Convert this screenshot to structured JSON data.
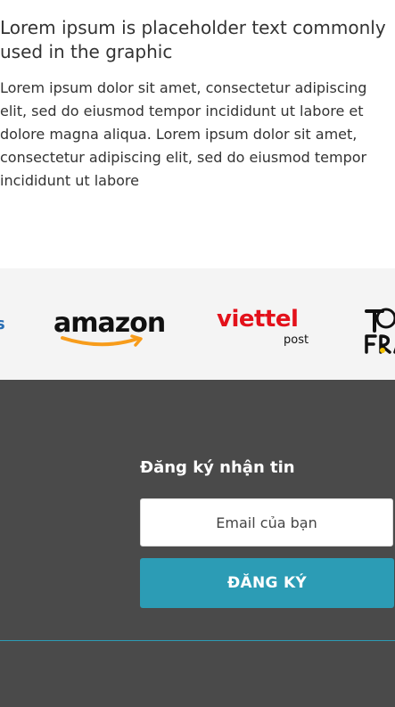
{
  "intro": {
    "heading": "Lorem ipsum is placeholder text commonly used in the graphic",
    "body": "Lorem ipsum dolor sit amet, consectetur adipiscing elit, sed do eiusmod tempor incididunt ut labore et dolore magna aliqua. Lorem ipsum dolor sit amet, consectetur adipiscing elit, sed do eiusmod tempor incididunt ut labore"
  },
  "partners": {
    "logos": [
      {
        "name": "amazon",
        "text": "amazon",
        "color": "#111111",
        "accent": "#f79c1b"
      },
      {
        "name": "viettel",
        "text": "viettel",
        "sub": "post",
        "color": "#e3111b"
      },
      {
        "name": "tour-de-france",
        "text": "TO FRA"
      }
    ],
    "background": "#f4f4f4"
  },
  "footer": {
    "newsletter_title": "Đăng ký nhận tin",
    "email_placeholder": "Email của bạn",
    "submit_label": "ĐĂNG KÝ",
    "background": "#4a4a4a",
    "accent": "#2c9cb5"
  }
}
